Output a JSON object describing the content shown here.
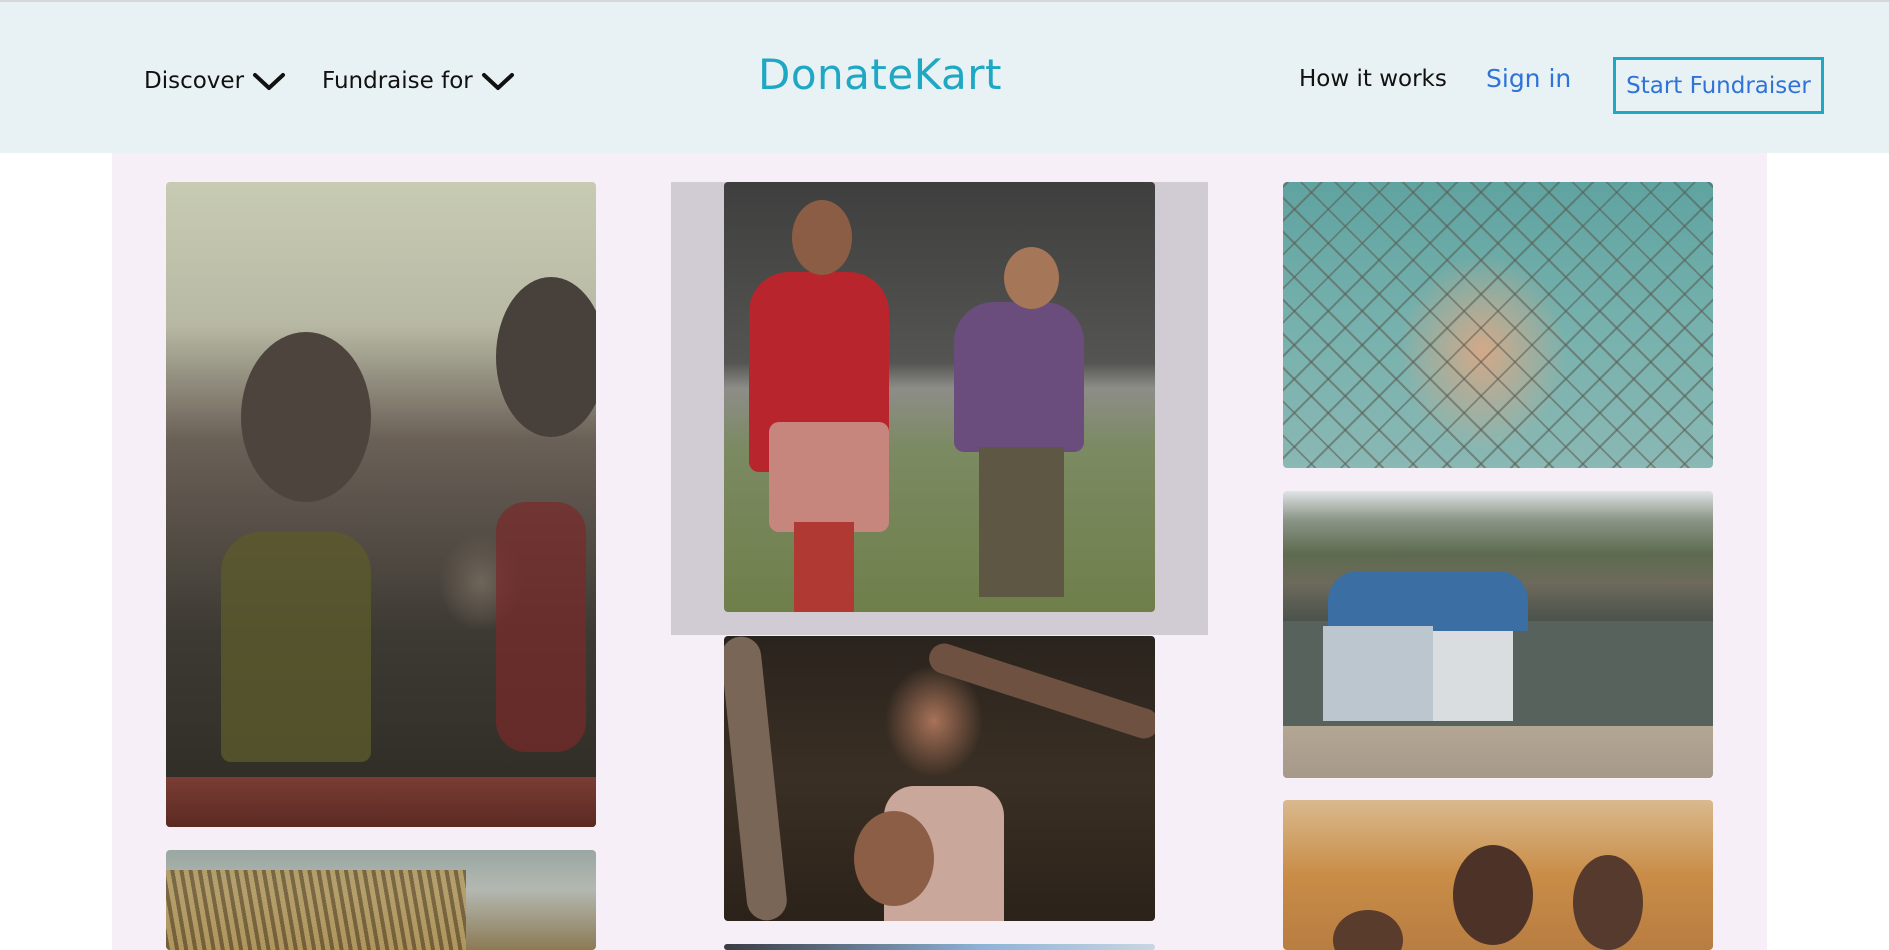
{
  "header": {
    "nav_left": [
      {
        "label": "Discover"
      },
      {
        "label": "Fundraise for"
      }
    ],
    "brand": "DonateKart",
    "how_it_works": "How it works",
    "sign_in": "Sign in",
    "start_fundraiser": "Start Fundraiser"
  },
  "gallery": {
    "photos": [
      {
        "subject": "muddy-children-laughing-photo"
      },
      {
        "subject": "girl-carrying-baby-and-boy-with-puppy-photo"
      },
      {
        "subject": "girl-behind-chain-fence-photo"
      },
      {
        "subject": "two-children-by-tree-photo"
      },
      {
        "subject": "tent-camp-photo"
      },
      {
        "subject": "three-smiling-children-photo"
      },
      {
        "subject": "thatched-hut-photo"
      },
      {
        "subject": "window-photo"
      }
    ]
  },
  "colors": {
    "header_bg": "#e8f1f3",
    "brand": "#1fa8c4",
    "link_blue": "#2f73d8",
    "gallery_bg": "#f7eff7",
    "highlight": "#d1ccd3"
  },
  "icons": {
    "dropdown": "chevron-down-icon"
  }
}
